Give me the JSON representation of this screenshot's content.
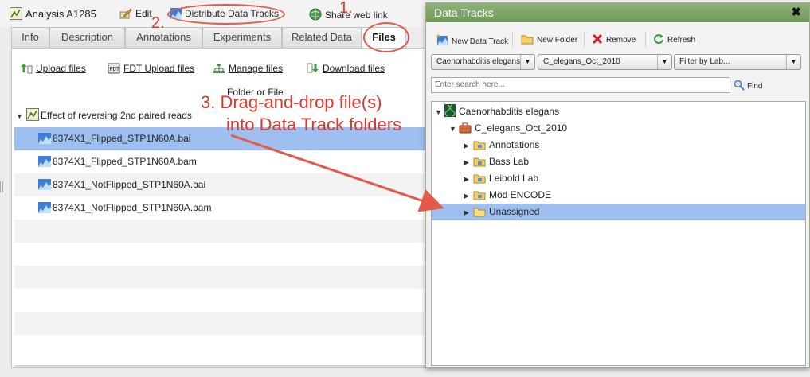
{
  "analysis": {
    "title": "Analysis A1285"
  },
  "toolbar": {
    "edit_label": "Edit",
    "distribute_label": "Distribute Data Tracks",
    "share_label": "Share web link"
  },
  "tabs": [
    {
      "label": "Info"
    },
    {
      "label": "Description"
    },
    {
      "label": "Annotations"
    },
    {
      "label": "Experiments"
    },
    {
      "label": "Related Data"
    },
    {
      "label": "Files",
      "active": true
    }
  ],
  "files_toolbar": {
    "upload_label": "Upload files",
    "fdt_upload_label": "FDT Upload files",
    "manage_label": "Manage files",
    "download_label": "Download files"
  },
  "files_grid": {
    "column_header": "Folder or File",
    "folder_name": "Effect of reversing 2nd paired reads",
    "files": [
      {
        "name": "8374X1_Flipped_STP1N60A.bai",
        "selected": true
      },
      {
        "name": "8374X1_Flipped_STP1N60A.bam",
        "selected": false
      },
      {
        "name": "8374X1_NotFlipped_STP1N60A.bai",
        "selected": false
      },
      {
        "name": "8374X1_NotFlipped_STP1N60A.bam",
        "selected": false
      }
    ]
  },
  "data_tracks_dialog": {
    "title": "Data Tracks",
    "close_symbol": "✖",
    "toolbar": {
      "new_data_track_label": "New Data Track",
      "new_folder_label": "New Folder",
      "remove_label": "Remove",
      "refresh_label": "Refresh"
    },
    "organism_select": "Caenorhabditis elegans",
    "genome_build_select": "C_elegans_Oct_2010",
    "lab_filter_select": "Filter by Lab...",
    "search_placeholder": "Enter search here...",
    "find_label": "Find",
    "tree": {
      "organism": "Caenorhabditis elegans",
      "genome_build": "C_elegans_Oct_2010",
      "folders": [
        {
          "name": "Annotations",
          "selected": false
        },
        {
          "name": "Bass Lab",
          "selected": false
        },
        {
          "name": "Leibold Lab",
          "selected": false
        },
        {
          "name": "Mod ENCODE",
          "selected": false
        },
        {
          "name": "Unassigned",
          "selected": true
        }
      ]
    }
  },
  "annotations": {
    "step1": "1.",
    "step2": "2.",
    "step3_line1": "3. Drag-and-drop file(s)",
    "step3_line2": "into Data Track folders"
  },
  "colors": {
    "selection": "#9ebff0",
    "dialog_header": "#7ea669",
    "annotation_red": "#d63a2c"
  }
}
